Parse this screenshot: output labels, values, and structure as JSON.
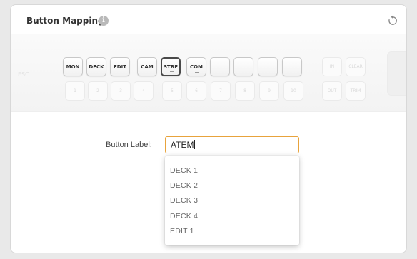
{
  "panel": {
    "title": "Button Mapping",
    "info_icon_glyph": "i",
    "reset_icon": "reset-icon"
  },
  "keyboard": {
    "left_label": "ESC",
    "top_row": [
      {
        "label": "MON"
      },
      {
        "label": "DECK"
      },
      {
        "label": "EDIT"
      },
      {
        "label": "CAM"
      },
      {
        "label": "STRE",
        "selected": true
      },
      {
        "label": "COM"
      },
      {
        "label": ""
      },
      {
        "label": ""
      },
      {
        "label": ""
      },
      {
        "label": ""
      }
    ],
    "bottom_row": [
      "1",
      "2",
      "3",
      "4",
      "5",
      "6",
      "7",
      "8",
      "9",
      "10"
    ],
    "right_top": [
      "IN",
      "CLEAR"
    ],
    "right_bottom": [
      "OUT",
      "TRIM"
    ]
  },
  "form": {
    "label": "Button Label:",
    "value": "ATEM"
  },
  "dropdown": {
    "options": [
      "DECK 1",
      "DECK 2",
      "DECK 3",
      "DECK 4",
      "EDIT 1"
    ]
  },
  "colors": {
    "accent": "#e8a33c",
    "panel_bg": "#ffffff",
    "page_bg": "#e9e9e9"
  }
}
